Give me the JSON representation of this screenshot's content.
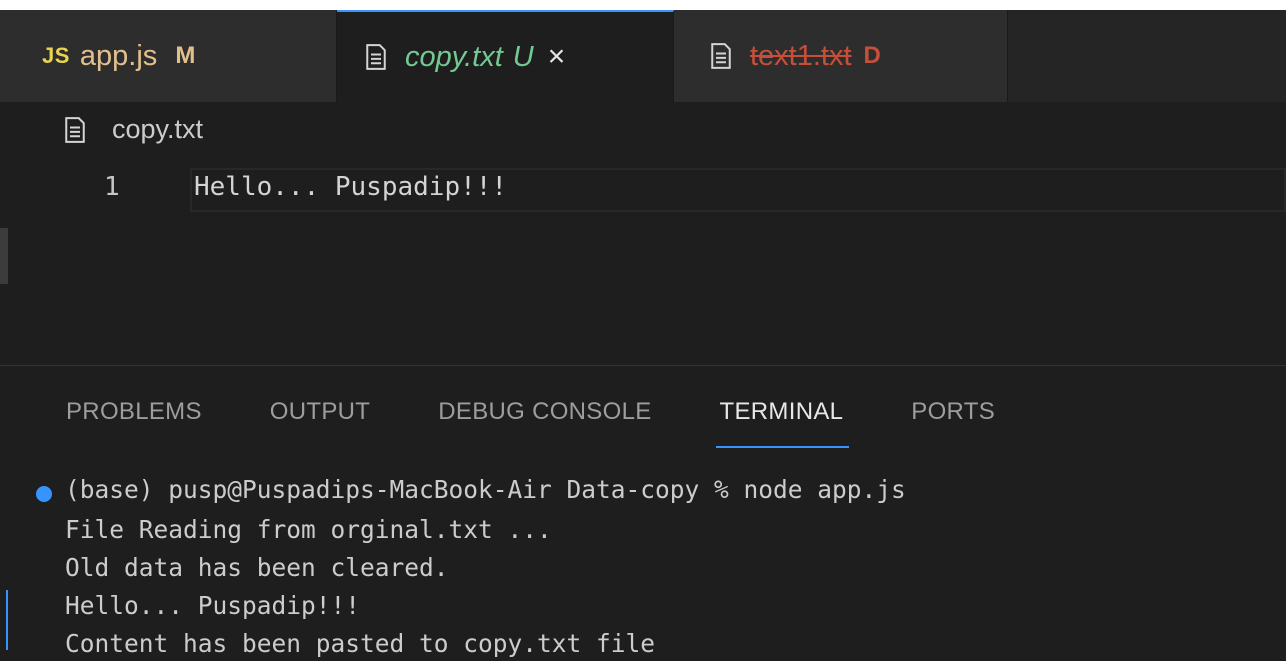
{
  "tabs": [
    {
      "icon": "JS",
      "name": "app.js",
      "badge": "M",
      "active": false
    },
    {
      "icon": "file-icon",
      "name": "copy.txt",
      "badge": "U",
      "close": "×",
      "active": true
    },
    {
      "icon": "file-icon",
      "name": "text1.txt",
      "badge": "D",
      "active": false
    }
  ],
  "breadcrumb": {
    "file": "copy.txt"
  },
  "editor": {
    "lines": [
      {
        "number": "1",
        "text": "Hello... Puspadip!!!"
      }
    ]
  },
  "panel": {
    "tabs": [
      "PROBLEMS",
      "OUTPUT",
      "DEBUG CONSOLE",
      "TERMINAL",
      "PORTS"
    ],
    "active_tab": "TERMINAL"
  },
  "terminal": {
    "lines": [
      "(base) pusp@Puspadips-MacBook-Air Data-copy % node app.js",
      "File Reading from orginal.txt ...",
      "Old data has been cleared.",
      "Hello... Puspadip!!!",
      "Content has been pasted to copy.txt file"
    ]
  },
  "colors": {
    "modified": "#e2c08d",
    "untracked": "#73c991",
    "deleted": "#c74e39",
    "accent": "#3794ff",
    "js_icon": "#e8d44d"
  }
}
